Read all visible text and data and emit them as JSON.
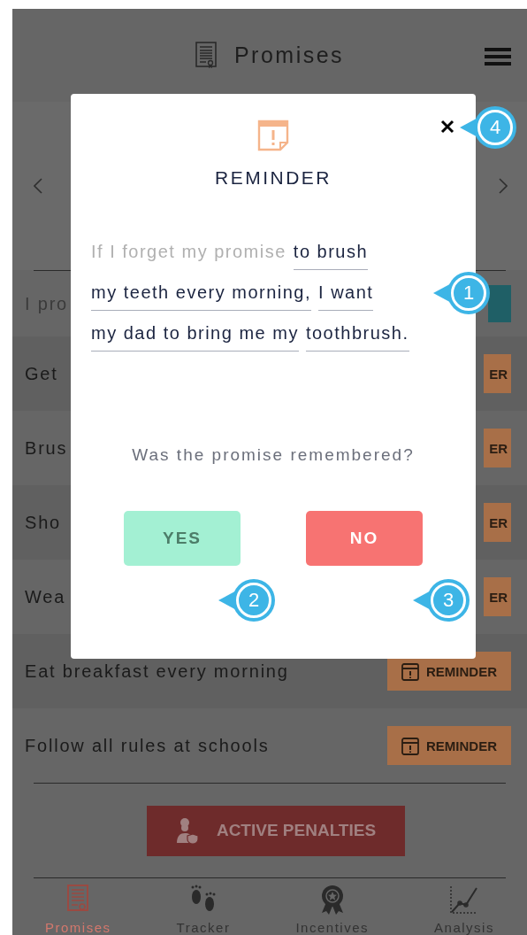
{
  "header": {
    "title": "Promises"
  },
  "rows": [
    {
      "label": "I pro",
      "kind": "active",
      "button": {
        "cut": true
      }
    },
    {
      "label": "Get",
      "kind": "reminder",
      "button": {
        "label": "ER",
        "cut": true
      }
    },
    {
      "label": "Brus",
      "kind": "reminder",
      "button": {
        "label": "ER",
        "cut": true
      }
    },
    {
      "label": "Sho",
      "kind": "reminder",
      "button": {
        "label": "ER",
        "cut": true
      }
    },
    {
      "label": "Wea",
      "kind": "reminder",
      "button": {
        "label": "ER",
        "cut": true
      }
    },
    {
      "label": "Eat breakfast every morning",
      "kind": "reminder",
      "button": {
        "label": "REMINDER",
        "cut": false
      }
    },
    {
      "label": "Follow all rules at schools",
      "kind": "reminder",
      "button": {
        "label": "REMINDER",
        "cut": false
      }
    }
  ],
  "penalties_button": {
    "label": "ACTIVE PENALTIES"
  },
  "nav": [
    {
      "label": "Promises",
      "selected": true
    },
    {
      "label": "Tracker",
      "selected": false
    },
    {
      "label": "Incentives",
      "selected": false
    },
    {
      "label": "Analysis",
      "selected": false
    }
  ],
  "modal": {
    "title": "REMINDER",
    "prompt": "If I forget my promise",
    "answers": [
      "to brush",
      "my teeth every morning,",
      "I want",
      "my dad to bring me my",
      "toothbrush."
    ],
    "question": "Was the promise remembered?",
    "buttons": [
      {
        "label": "YES",
        "kind": "yes"
      },
      {
        "label": "NO",
        "kind": "no"
      }
    ]
  },
  "callouts": [
    {
      "number": "4"
    },
    {
      "number": "1"
    },
    {
      "number": "2"
    },
    {
      "number": "3"
    }
  ]
}
